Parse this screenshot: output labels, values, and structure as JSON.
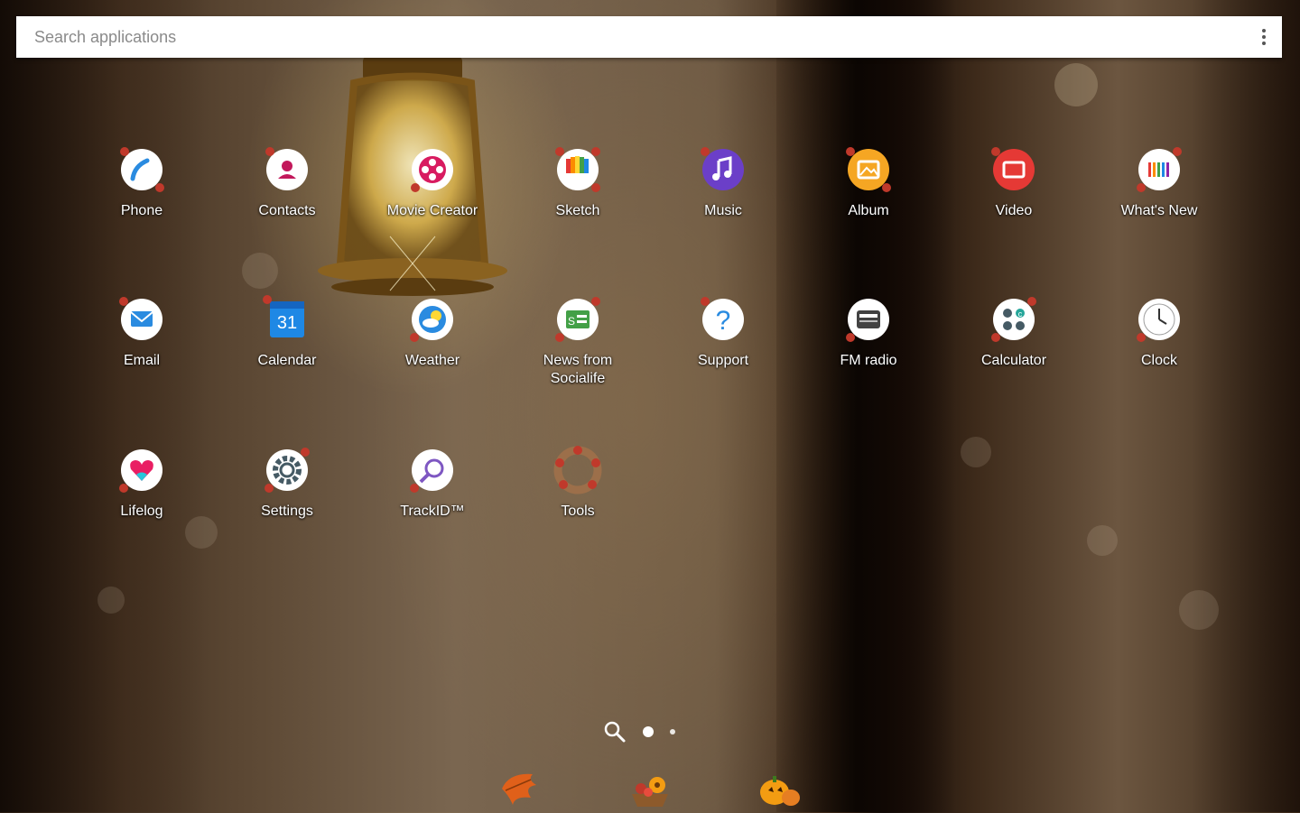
{
  "search": {
    "placeholder": "Search applications"
  },
  "apps": [
    {
      "id": "phone",
      "label": "Phone",
      "icon": "phone-icon",
      "color": "#ffffff"
    },
    {
      "id": "contacts",
      "label": "Contacts",
      "icon": "contacts-icon",
      "color": "#ffffff"
    },
    {
      "id": "movie-creator",
      "label": "Movie Creator",
      "icon": "movie-creator-icon",
      "color": "#ffffff"
    },
    {
      "id": "sketch",
      "label": "Sketch",
      "icon": "sketch-icon",
      "color": "#ffffff"
    },
    {
      "id": "music",
      "label": "Music",
      "icon": "music-icon",
      "color": "#6b3fc8"
    },
    {
      "id": "album",
      "label": "Album",
      "icon": "album-icon",
      "color": "#f5a623"
    },
    {
      "id": "video",
      "label": "Video",
      "icon": "video-icon",
      "color": "#e53935"
    },
    {
      "id": "whats-new",
      "label": "What's New",
      "icon": "whats-new-icon",
      "color": "#ffffff"
    },
    {
      "id": "email",
      "label": "Email",
      "icon": "email-icon",
      "color": "#ffffff"
    },
    {
      "id": "calendar",
      "label": "Calendar",
      "icon": "calendar-icon",
      "color": "#1e88e5",
      "text": "31"
    },
    {
      "id": "weather",
      "label": "Weather",
      "icon": "weather-icon",
      "color": "#ffffff"
    },
    {
      "id": "news",
      "label": "News from\nSocialife",
      "icon": "news-icon",
      "color": "#ffffff",
      "text": "S"
    },
    {
      "id": "support",
      "label": "Support",
      "icon": "support-icon",
      "color": "#ffffff",
      "text": "?"
    },
    {
      "id": "fm-radio",
      "label": "FM radio",
      "icon": "radio-icon",
      "color": "#ffffff"
    },
    {
      "id": "calculator",
      "label": "Calculator",
      "icon": "calculator-icon",
      "color": "#ffffff",
      "text": "c"
    },
    {
      "id": "clock",
      "label": "Clock",
      "icon": "clock-icon",
      "color": "#ffffff"
    },
    {
      "id": "lifelog",
      "label": "Lifelog",
      "icon": "lifelog-icon",
      "color": "#ffffff"
    },
    {
      "id": "settings",
      "label": "Settings",
      "icon": "settings-icon",
      "color": "#ffffff"
    },
    {
      "id": "trackid",
      "label": "TrackID™",
      "icon": "trackid-icon",
      "color": "#ffffff"
    },
    {
      "id": "tools",
      "label": "Tools",
      "icon": "tools-folder-icon",
      "color": "#a0704a"
    }
  ],
  "pager": {
    "pages": 2,
    "current": 1
  },
  "dock": [
    {
      "id": "leaf",
      "icon": "autumn-leaf-icon"
    },
    {
      "id": "bouquet",
      "icon": "flower-basket-icon"
    },
    {
      "id": "pumpkin",
      "icon": "pumpkin-icon"
    }
  ],
  "accent": {
    "leaf": "#c0392b",
    "text": "#ffffff"
  }
}
